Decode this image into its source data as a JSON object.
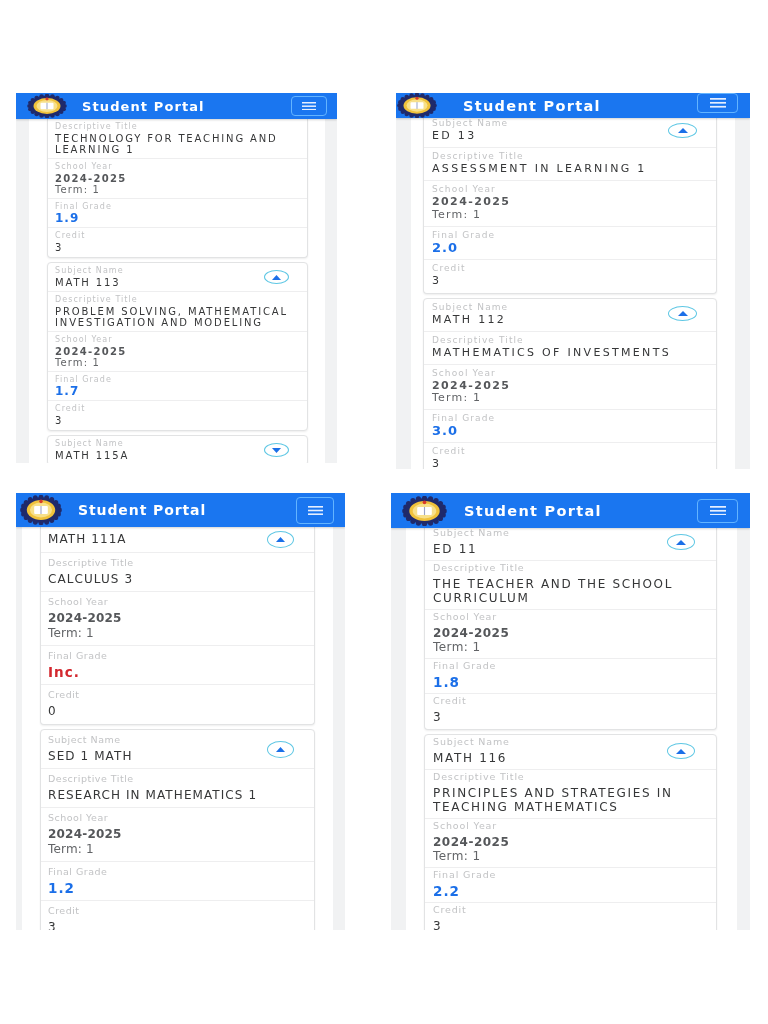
{
  "screens": [
    {
      "header": {
        "title": "Student Portal"
      },
      "cards": [
        {
          "fields": [
            {
              "kind": "title",
              "label": "Descriptive Title",
              "value": "TECHNOLOGY FOR TEACHING AND LEARNING 1"
            },
            {
              "kind": "year",
              "label": "School Year",
              "value": "2024-2025",
              "term": "Term: 1"
            },
            {
              "kind": "grade",
              "label": "Final Grade",
              "value": "1.9",
              "incomplete": false
            },
            {
              "kind": "credit",
              "label": "Credit",
              "value": "3"
            }
          ]
        },
        {
          "expanded": true,
          "fields": [
            {
              "kind": "subject",
              "label": "Subject Name",
              "value": "MATH 113"
            },
            {
              "kind": "title",
              "label": "Descriptive Title",
              "value": "PROBLEM SOLVING, MATHEMATICAL INVESTIGATION AND MODELING"
            },
            {
              "kind": "year",
              "label": "School Year",
              "value": "2024-2025",
              "term": "Term: 1"
            },
            {
              "kind": "grade",
              "label": "Final Grade",
              "value": "1.7",
              "incomplete": false
            },
            {
              "kind": "credit",
              "label": "Credit",
              "value": "3"
            }
          ]
        },
        {
          "expanded": false,
          "fields": [
            {
              "kind": "subject",
              "label": "Subject Name",
              "value": "MATH 115A"
            }
          ]
        }
      ]
    },
    {
      "header": {
        "title": "Student Portal"
      },
      "cards": [
        {
          "expanded": true,
          "fields": [
            {
              "kind": "subject",
              "label": "Subject Name",
              "value": "ED 13"
            },
            {
              "kind": "title",
              "label": "Descriptive Title",
              "value": "ASSESSMENT IN LEARNING 1"
            },
            {
              "kind": "year",
              "label": "School Year",
              "value": "2024-2025",
              "term": "Term: 1"
            },
            {
              "kind": "grade",
              "label": "Final Grade",
              "value": "2.0",
              "incomplete": false
            },
            {
              "kind": "credit",
              "label": "Credit",
              "value": "3"
            }
          ]
        },
        {
          "expanded": true,
          "fields": [
            {
              "kind": "subject",
              "label": "Subject Name",
              "value": "MATH 112"
            },
            {
              "kind": "title",
              "label": "Descriptive Title",
              "value": "MATHEMATICS OF INVESTMENTS"
            },
            {
              "kind": "year",
              "label": "School Year",
              "value": "2024-2025",
              "term": "Term: 1"
            },
            {
              "kind": "grade",
              "label": "Final Grade",
              "value": "3.0",
              "incomplete": false
            },
            {
              "kind": "credit",
              "label": "Credit",
              "value": "3"
            }
          ]
        }
      ]
    },
    {
      "header": {
        "title": "Student Portal"
      },
      "cards": [
        {
          "expanded": true,
          "fields": [
            {
              "kind": "subject",
              "value": "MATH 111A"
            },
            {
              "kind": "title",
              "label": "Descriptive Title",
              "value": "CALCULUS 3"
            },
            {
              "kind": "year",
              "label": "School Year",
              "value": "2024-2025",
              "term": "Term: 1"
            },
            {
              "kind": "grade",
              "label": "Final Grade",
              "value": "Inc.",
              "incomplete": true
            },
            {
              "kind": "credit",
              "label": "Credit",
              "value": "0"
            }
          ]
        },
        {
          "expanded": true,
          "fields": [
            {
              "kind": "subject",
              "label": "Subject Name",
              "value": "SED 1 MATH"
            },
            {
              "kind": "title",
              "label": "Descriptive Title",
              "value": "RESEARCH IN MATHEMATICS 1"
            },
            {
              "kind": "year",
              "label": "School Year",
              "value": "2024-2025",
              "term": "Term: 1"
            },
            {
              "kind": "grade",
              "label": "Final Grade",
              "value": "1.2",
              "incomplete": false
            },
            {
              "kind": "credit",
              "label": "Credit",
              "value": "3"
            }
          ]
        }
      ]
    },
    {
      "header": {
        "title": "Student Portal"
      },
      "cards": [
        {
          "expanded": true,
          "fields": [
            {
              "kind": "subject",
              "label": "Subject Name",
              "value": "ED 11"
            },
            {
              "kind": "title",
              "label": "Descriptive Title",
              "value": "THE TEACHER AND THE SCHOOL CURRICULUM"
            },
            {
              "kind": "year",
              "label": "School Year",
              "value": "2024-2025",
              "term": "Term: 1"
            },
            {
              "kind": "grade",
              "label": "Final Grade",
              "value": "1.8",
              "incomplete": false
            },
            {
              "kind": "credit",
              "label": "Credit",
              "value": "3"
            }
          ]
        },
        {
          "expanded": true,
          "fields": [
            {
              "kind": "subject",
              "label": "Subject Name",
              "value": "MATH 116"
            },
            {
              "kind": "title",
              "label": "Descriptive Title",
              "value": "PRINCIPLES AND STRATEGIES IN TEACHING MATHEMATICS"
            },
            {
              "kind": "year",
              "label": "School Year",
              "value": "2024-2025",
              "term": "Term: 1"
            },
            {
              "kind": "grade",
              "label": "Final Grade",
              "value": "2.2",
              "incomplete": false
            },
            {
              "kind": "credit",
              "label": "Credit",
              "value": "3"
            }
          ]
        }
      ]
    }
  ]
}
